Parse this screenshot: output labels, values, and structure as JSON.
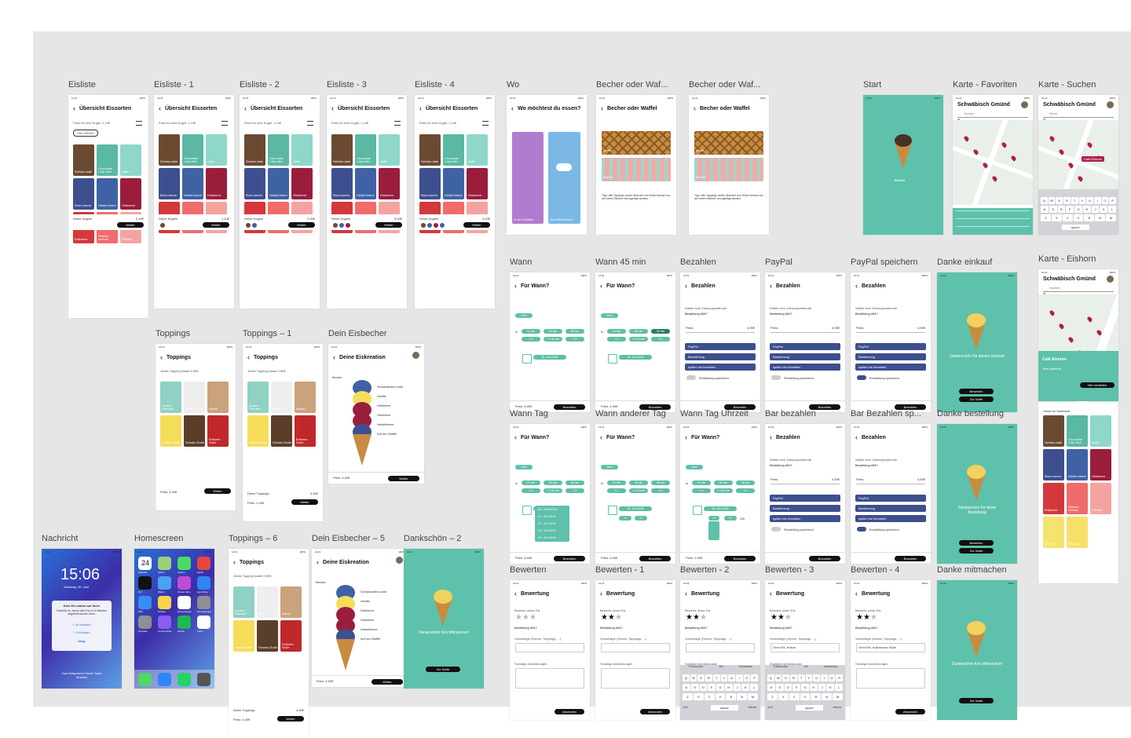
{
  "colors": {
    "teal": "#5ec1ab",
    "navy": "#3d4f8e",
    "black": "#111111",
    "canvas": "#e6e6e6"
  },
  "status": {
    "time": "14:21",
    "battery": "100%"
  },
  "artboards": {
    "eisliste": "Eisliste",
    "eisliste1": "Eisliste - 1",
    "eisliste2": "Eisliste - 2",
    "eisliste3": "Eisliste - 3",
    "eisliste4": "Eisliste - 4",
    "wo": "Wo",
    "becher1": "Becher oder Waf...",
    "becher2": "Becher oder Waf...",
    "start": "Start",
    "karteFav": "Karte - Favoriten",
    "karteSuchen": "Karte - Suchen",
    "wann": "Wann",
    "wann45": "Wann 45 min",
    "bezahlen": "Bezahlen",
    "paypal": "PayPal",
    "paypalSp": "PayPal speichern",
    "dankeEinkauf": "Danke einkauf",
    "karteEinhorn": "Karte - Eishorn",
    "toppings": "Toppings",
    "toppings1": "Toppings – 1",
    "deinEisbecher": "Dein Eisbecher",
    "wannTag": "Wann Tag",
    "wannAnderer": "Wann anderer Tag",
    "wannTagUhr": "Wann Tag Uhrzeit",
    "barBezahlen": "Bar bezahlen",
    "barBezahlenSp": "Bar Bezahlen sp...",
    "dankeBestellung": "Danke bestellung",
    "nachricht": "Nachricht",
    "homescreen": "Homescreen",
    "toppings6": "Toppings – 6",
    "deinEisbecher5": "Dein Eisbecher – 5",
    "dankeschoen2": "Dankschön – 2",
    "bewerten": "Bewerten",
    "bewerten1": "Bewerten - 1",
    "bewerten2": "Bewerten - 2",
    "bewerten3": "Bewerten - 3",
    "bewerten4": "Bewerten - 4",
    "dankeMitmachen": "Danke mitmachen"
  },
  "eis": {
    "title": "Übersicht Eissorten",
    "price_note": "Preis für eine Kugel: 1,10€",
    "filter": "Das Übliche",
    "flavors": [
      "Schoko-lade",
      "Chocolate Chip Mint",
      "Apfel",
      "Brom-beere",
      "Heidel-beere",
      "Himbeere",
      "Erdbeere",
      "Wasser-melone",
      "Pfirsich",
      "Vanille",
      "Zitrone"
    ],
    "your_scoops": "Deine Kugeln",
    "next": "Weiter",
    "totals": [
      "0,00€",
      "1,10€",
      "2,20€",
      "3,30€",
      "4,40€"
    ]
  },
  "wo": {
    "title": "Wo möchtest du essen?",
    "a": "In der Eisdiele",
    "b": "Zum Mitnehmen"
  },
  "becher": {
    "title": "Becher oder Waffel",
    "waffel": "Waffel",
    "becher": "Becher",
    "tipp": "Tipp: alle Toppings außer Streusel und Soße können nur auf einem Becher hinzugefügt werden."
  },
  "start": {
    "brand": "EisZeit"
  },
  "karte": {
    "city": "Schwäbisch Gmünd",
    "search": "Suchen",
    "search_typed": "Eisho",
    "cafe": "Café Eishorn",
    "open": "Jetzt geöffnet",
    "order": "Hier bestellen",
    "today": "Heute im Sortiment",
    "result": "Café Eishorn"
  },
  "wann": {
    "title": "Für Wann?",
    "now": "Jetzt",
    "in": "in",
    "chips": [
      "15 min",
      "30 min",
      "45 min",
      "1 h",
      "1 h 30 min",
      "2 h"
    ],
    "date": "30. Juni 2018",
    "dates": [
      "30. Juni 2018",
      "01. Juli 2018",
      "02. Juli 2018",
      "03. Juli 2018",
      "04. Juli 2018"
    ],
    "hour": "14",
    "minute": "21",
    "uhr": "Uhr"
  },
  "pay": {
    "title": "Bezahlen",
    "hint": "Wähle eine Zahlungsmethode",
    "order": "Bestellung #547",
    "price": "Preis:",
    "amount": "4,90€",
    "options": [
      "PayPal",
      "Bankeinzug",
      "später bar bezahlen"
    ],
    "save": "Einstellung speichern",
    "button": "Bezahlen"
  },
  "price_line": "Preis: 4,90€",
  "price_line2": "Preis: 4,40€",
  "danke": {
    "einkauf": "Dankeschön für deinen Einkauf",
    "bestellung": "Dankeschön für deine Bestellung",
    "mitmachen": "Dankeschön fürs Mitmachen!",
    "rate": "Bewerten",
    "map": "Zur Karte"
  },
  "toppings": {
    "title": "Toppings",
    "note": "Jedes Topping kostet 0,50€",
    "items": [
      "Zucker-Streusel",
      "Sahne",
      "Nüsse",
      "Vanille-Soße",
      "Schoko-Soße",
      "Erdbeer-Soße"
    ],
    "yours": "Deine Toppings",
    "total": "4,90€"
  },
  "eisbecher": {
    "title": "Deine Eiskreation",
    "cup": "Becher",
    "layers": [
      "Schokoladen-soße",
      "Vanille",
      "Himbeere",
      "Himbeere",
      "Heidelbeere",
      "Auf der Waffel"
    ]
  },
  "nachricht": {
    "time": "15:06",
    "date": "Samstag, 30. Juni",
    "notif_title": "Dein Eis wartet auf dich!",
    "notif_body": "Genieße es, bevor dein Eis in 15 Minuten abgeholt werden kann.",
    "a1": "+ 10 Minuten",
    "a2": "+ 5 Minuten",
    "ok": "Okay",
    "unlock": "Zum Entsperren Home-Taste drücken"
  },
  "home": {
    "apps": [
      "Kalender",
      "Karten",
      "Telefon",
      "Musik",
      "Uhr",
      "Wetter",
      "iTunes Store",
      "App Store",
      "Mail",
      "Notizen",
      "Erinnerungen",
      "Einstellungen",
      "Kontakte",
      "Social Media",
      "Spotify",
      "Fotos"
    ],
    "day": "24",
    "weekday": "Samstag"
  },
  "bewerten": {
    "title": "Bewertung",
    "rate_label": "Bewerte unser Eis",
    "order": "Bestellung #547",
    "sugg": "Vorschläge (Sorten, Toppings, ...)",
    "sugg_typed": "Oreo Eis, Kokos",
    "sugg_typed2": "Oreo Eis, Kokosnuss Soße",
    "remarks": "Sonstige Anmerkungen",
    "send": "Absenden",
    "suggestions": [
      "\"Kokosnuss\"",
      "Eis",
      "Kokosnuss"
    ],
    "space": "space",
    "return": "return",
    "numbers": "123"
  },
  "keyboard": {
    "row1": "QWERTYUIOP",
    "row2": "ASDFGHJKL",
    "row3": "ZXCVBNM"
  }
}
